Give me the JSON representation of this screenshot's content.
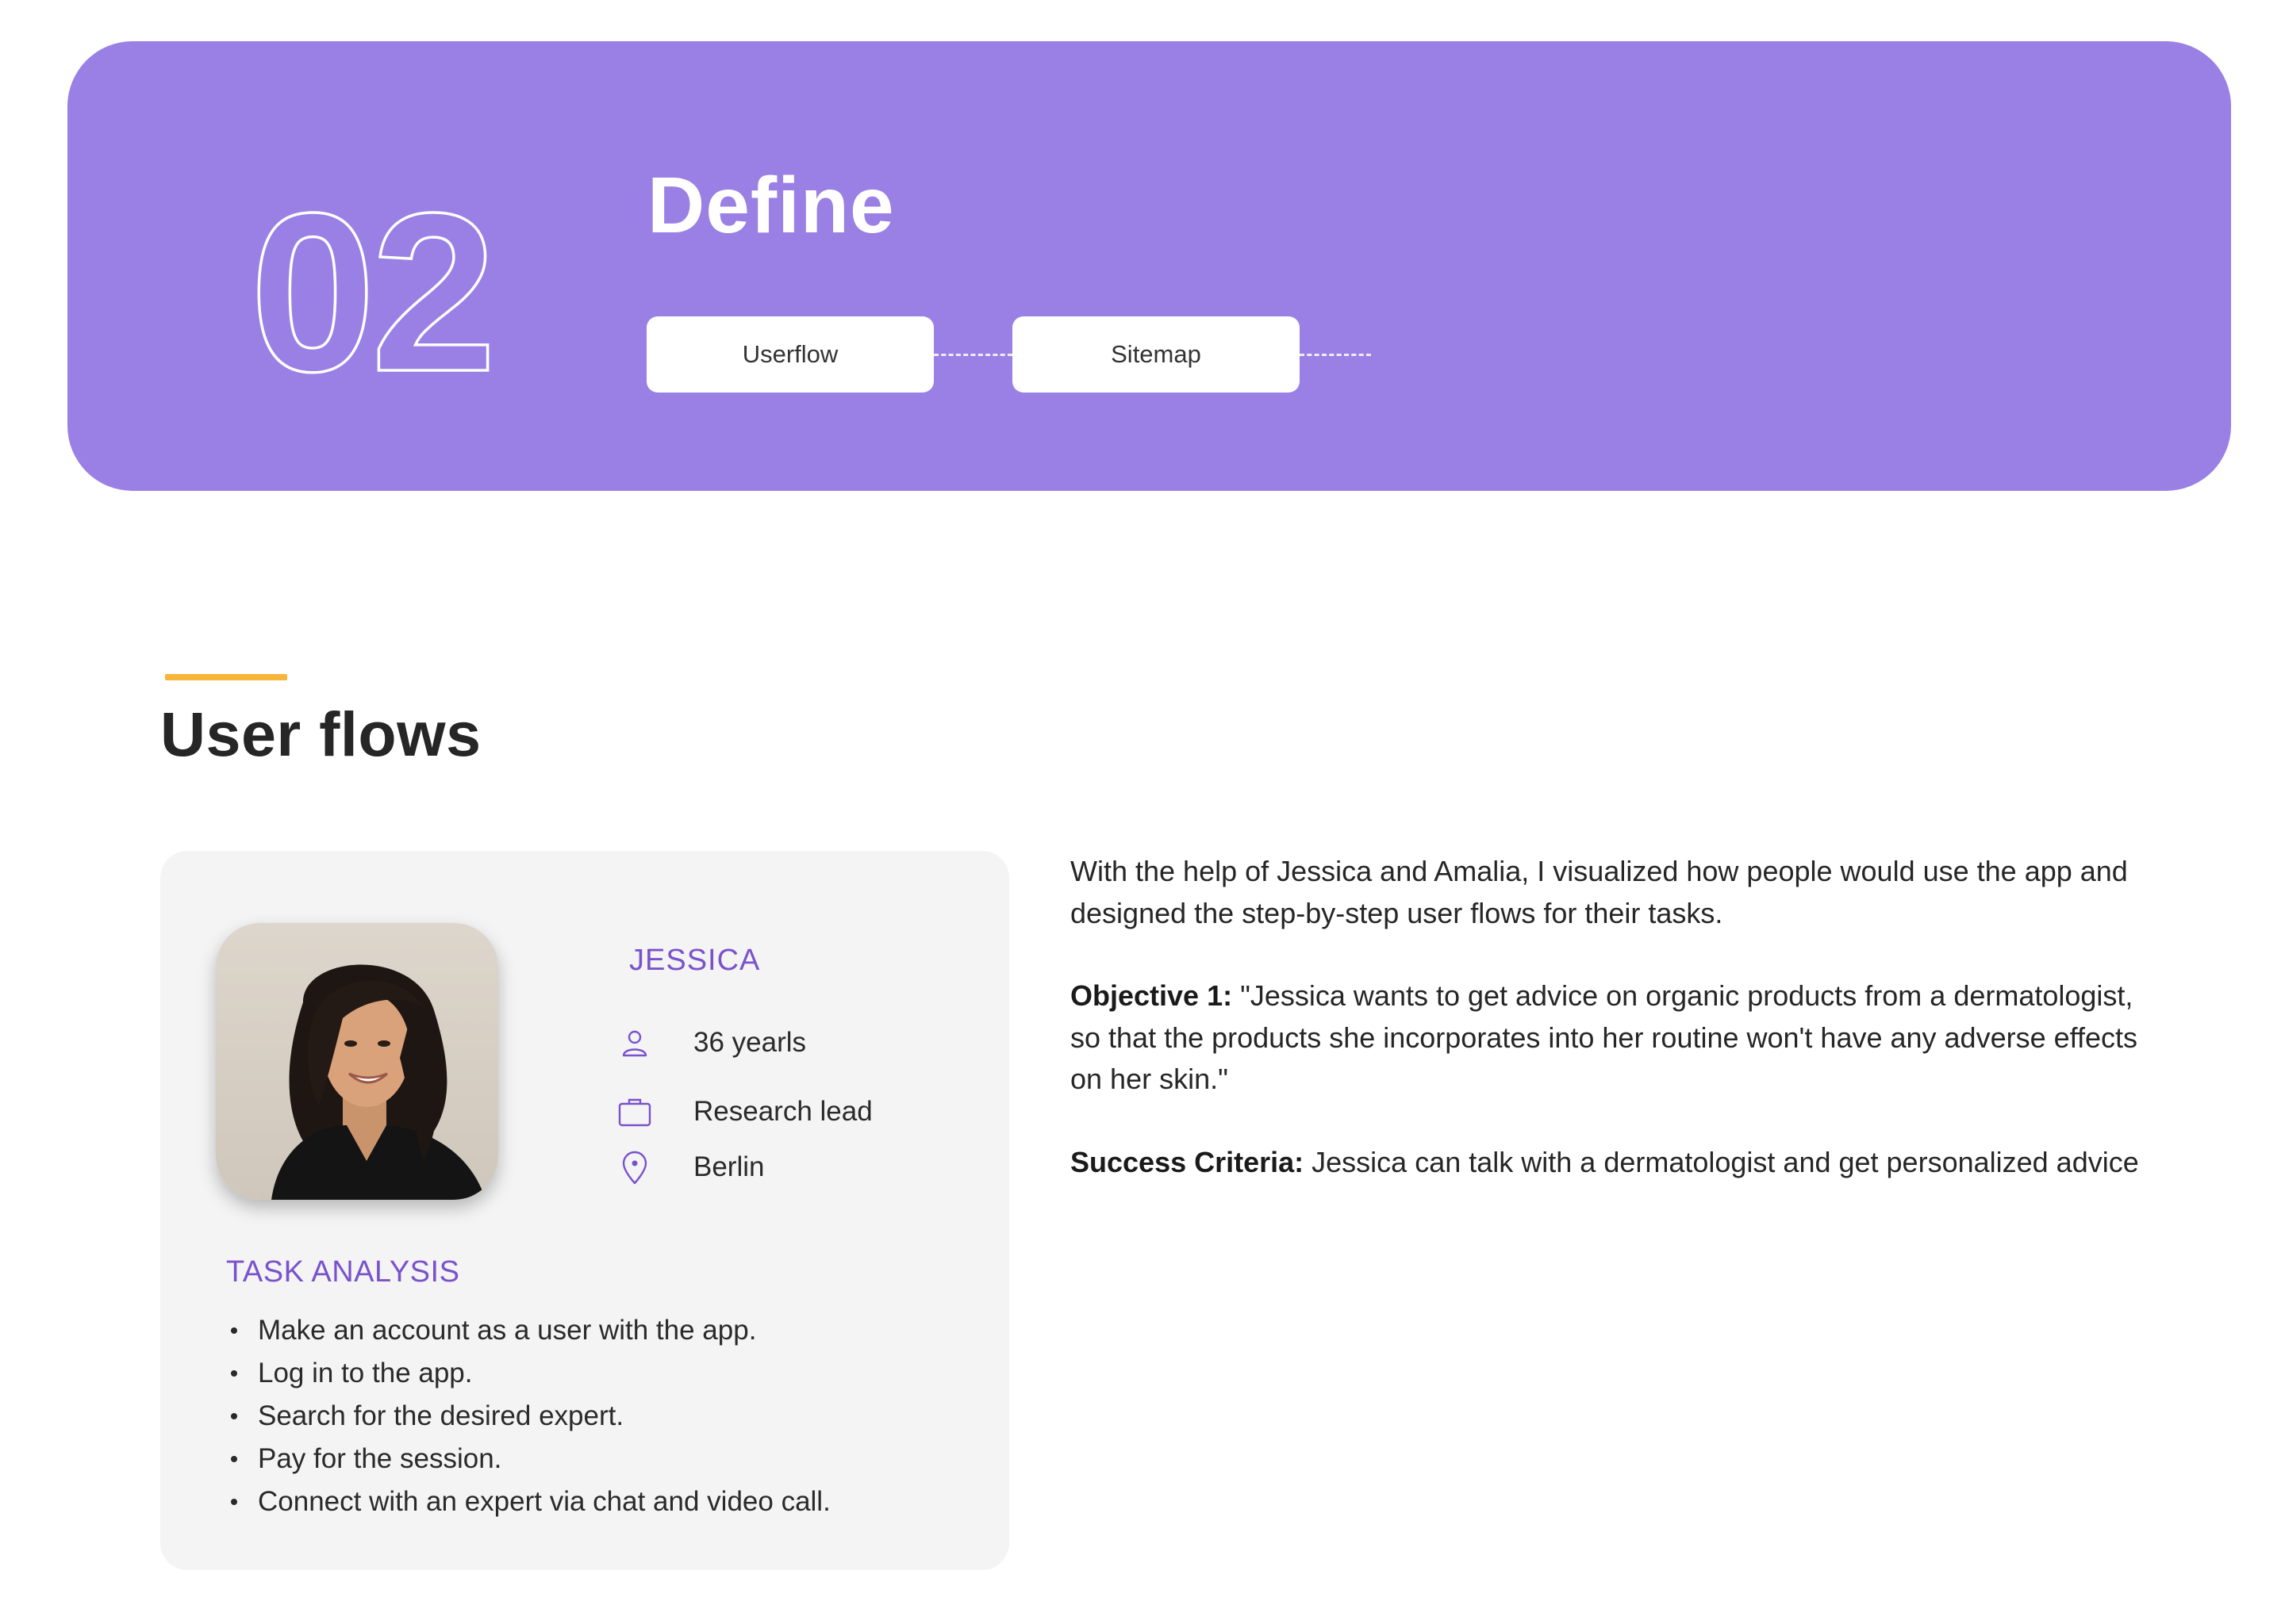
{
  "hero": {
    "number": "02",
    "title": "Define",
    "steps": [
      {
        "label": "Userflow"
      },
      {
        "label": "Sitemap"
      }
    ],
    "background_color": "#9a80e5"
  },
  "section": {
    "title": "User flows",
    "accent_color": "#f7b53a"
  },
  "persona": {
    "name": "JESSICA",
    "age": "36 yearls",
    "role": "Research lead",
    "location": "Berlin",
    "icons": [
      "user-icon",
      "briefcase-icon",
      "location-pin-icon"
    ],
    "task_heading": "TASK ANALYSIS",
    "tasks": [
      "Make an account as a user with the app.",
      "Log in to the app.",
      "Search for the desired expert.",
      "Pay for the session.",
      "Connect with an expert via chat and video call."
    ]
  },
  "description": {
    "intro": "With the help of Jessica and Amalia, I visualized how people would use the app and designed the step-by-step user flows for their tasks.",
    "objective_label": "Objective 1:",
    "objective_text": " \"Jessica  wants to get advice on organic products from a dermatologist, so that the products she incorporates into her routine won't have any adverse effects on her skin.\"",
    "success_label": "Success Criteria:",
    "success_text": " Jessica can talk with a dermatologist and get personalized advice"
  }
}
